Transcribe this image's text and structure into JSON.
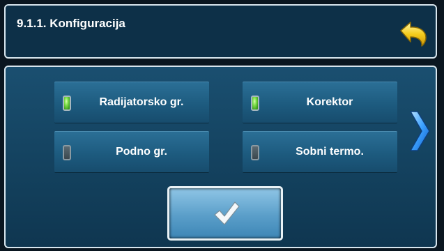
{
  "header": {
    "title": "9.1.1. Konfiguracija",
    "back_icon": "back-arrow-icon"
  },
  "options": [
    {
      "label": "Radijatorsko gr.",
      "state": "on"
    },
    {
      "label": "Korektor",
      "state": "on"
    },
    {
      "label": "Podno gr.",
      "state": "off"
    },
    {
      "label": "Sobni termo.",
      "state": "off"
    }
  ],
  "navigation": {
    "next_icon": "chevron-right-icon"
  },
  "confirm": {
    "icon": "checkmark-icon"
  },
  "colors": {
    "led_on": "#7fe04a",
    "led_off": "#4a575e",
    "back_arrow": "#f2c21a",
    "chevron": "#3aa0ff"
  }
}
